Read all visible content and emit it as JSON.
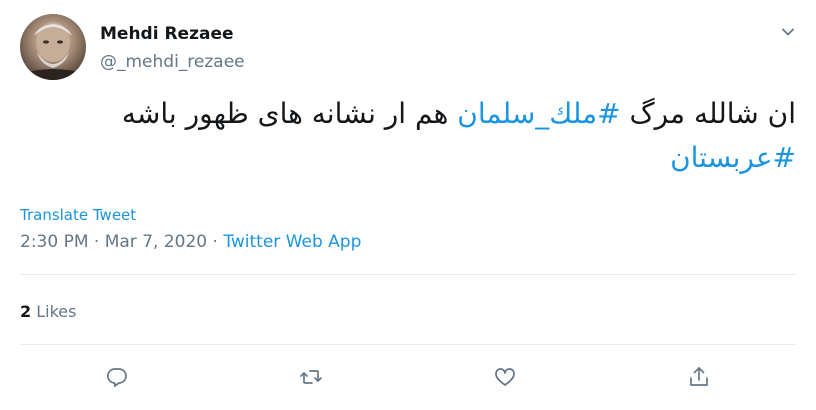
{
  "author": {
    "display_name": "Mehdi Rezaee",
    "handle": "@_mehdi_rezaee",
    "avatar_icon": "profile-photo"
  },
  "tweet": {
    "text_before": "ان شالله مرگ ",
    "hashtag_1": "#ملك_سلمان",
    "text_after": " هم ار نشانه های ظهور باشه ",
    "hashtag_2": "#عربستان"
  },
  "translate_label": "Translate Tweet",
  "meta": {
    "time": "2:30 PM",
    "separator_1": " · ",
    "date": "Mar 7, 2020",
    "separator_2": " · ",
    "source": "Twitter Web App"
  },
  "stats": {
    "likes_count": "2",
    "likes_label": "Likes"
  },
  "actions": [
    "reply-icon",
    "retweet-icon",
    "like-icon",
    "share-icon"
  ],
  "colors": {
    "accent": "#1b95e0",
    "secondary_text": "#657786",
    "primary_text": "#14171a",
    "divider": "#e6ecf0"
  }
}
